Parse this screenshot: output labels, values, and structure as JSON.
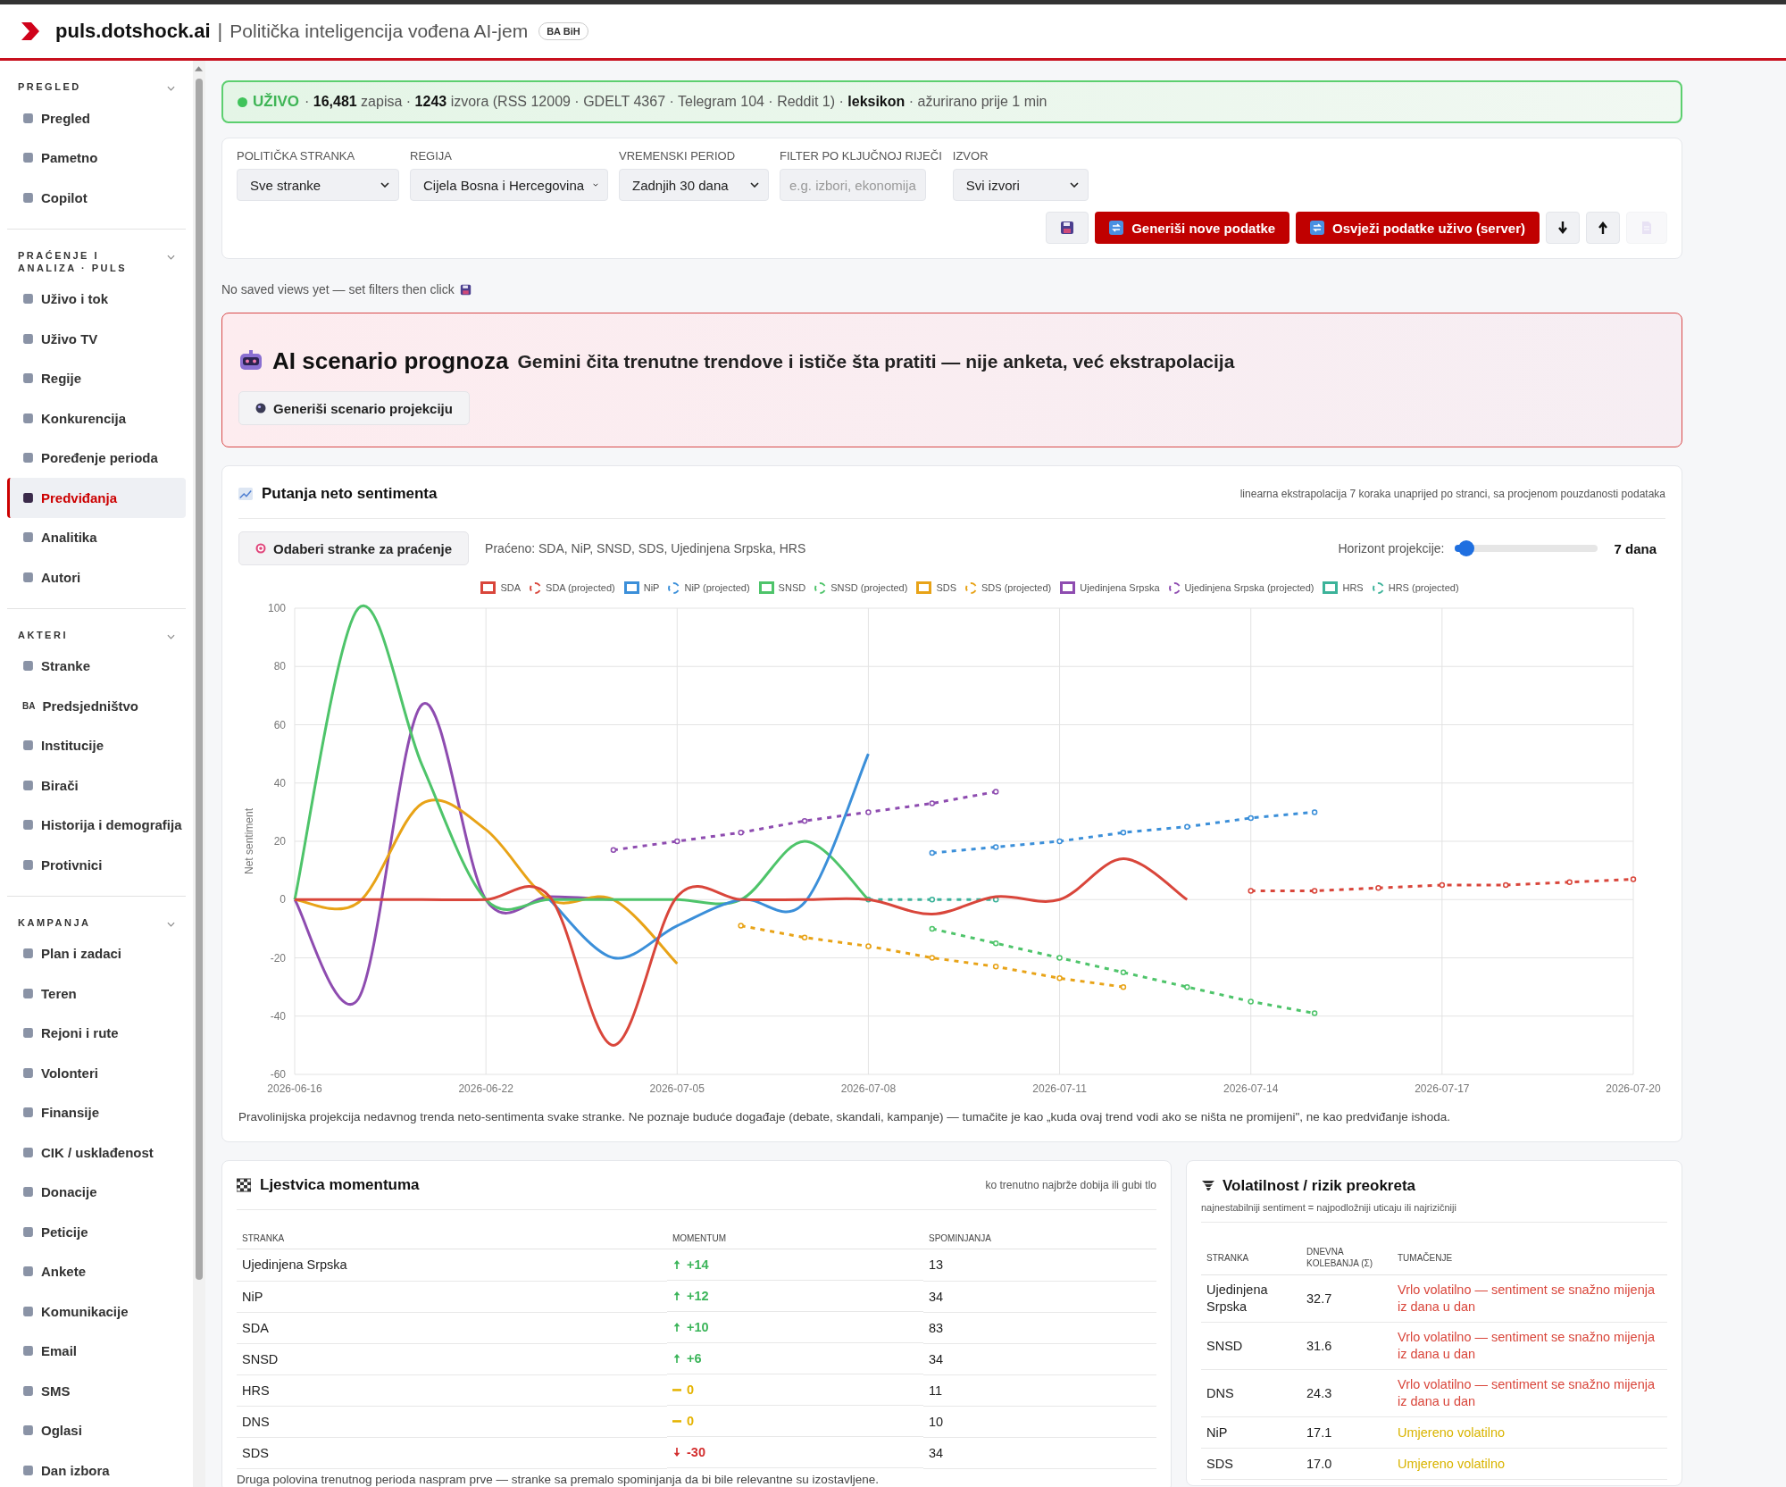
{
  "header": {
    "brand": "puls.dotshock.ai",
    "separator": "|",
    "tagline": "Politička inteligencija vođena AI-jem",
    "badge": "BA BiH"
  },
  "sidebar": {
    "sections": [
      {
        "title": "PREGLED",
        "items": [
          {
            "label": "Pregled",
            "selected": false
          },
          {
            "label": "Pametno",
            "selected": false
          },
          {
            "label": "Copilot",
            "selected": false
          }
        ]
      },
      {
        "title": "PRAĆENJE I ANALIZA · PULS",
        "items": [
          {
            "label": "Uživo i tok",
            "selected": false
          },
          {
            "label": "Uživo TV",
            "selected": false
          },
          {
            "label": "Regije",
            "selected": false
          },
          {
            "label": "Konkurencija",
            "selected": false
          },
          {
            "label": "Poređenje perioda",
            "selected": false
          },
          {
            "label": "Predviđanja",
            "selected": true
          },
          {
            "label": "Analitika",
            "selected": false
          },
          {
            "label": "Autori",
            "selected": false
          }
        ]
      },
      {
        "title": "AKTERI",
        "items": [
          {
            "label": "Stranke",
            "selected": false
          },
          {
            "label": "Predsjedništvo",
            "selected": false,
            "icon_text": "BA"
          },
          {
            "label": "Institucije",
            "selected": false
          },
          {
            "label": "Birači",
            "selected": false
          },
          {
            "label": "Historija i demografija",
            "selected": false
          },
          {
            "label": "Protivnici",
            "selected": false
          }
        ]
      },
      {
        "title": "KAMPANJA",
        "items": [
          {
            "label": "Plan i zadaci",
            "selected": false
          },
          {
            "label": "Teren",
            "selected": false
          },
          {
            "label": "Rejoni i rute",
            "selected": false
          },
          {
            "label": "Volonteri",
            "selected": false
          },
          {
            "label": "Finansije",
            "selected": false
          },
          {
            "label": "CIK / usklađenost",
            "selected": false
          },
          {
            "label": "Donacije",
            "selected": false
          },
          {
            "label": "Peticije",
            "selected": false
          },
          {
            "label": "Ankete",
            "selected": false
          },
          {
            "label": "Komunikacije",
            "selected": false
          },
          {
            "label": "Email",
            "selected": false
          },
          {
            "label": "SMS",
            "selected": false
          },
          {
            "label": "Oglasi",
            "selected": false
          },
          {
            "label": "Dan izbora",
            "selected": false
          }
        ]
      }
    ]
  },
  "live": {
    "status": "UŽIVO",
    "summary": "· **16,481** zapisa · **1243** izvora (RSS 12009 · GDELT 4367 · Telegram 104 · Reddit 1) · **leksikon** · ažurirano prije 1 min"
  },
  "filters": {
    "fields": [
      {
        "label": "POLITIČKA STRANKA",
        "kind": "select",
        "value": "Sve stranke"
      },
      {
        "label": "REGIJA",
        "kind": "select",
        "value": "Cijela Bosna i Hercegovina"
      },
      {
        "label": "VREMENSKI PERIOD",
        "kind": "select",
        "value": "Zadnjih 30 dana"
      },
      {
        "label": "FILTER PO KLJUČNOJ RIJEČI",
        "kind": "input",
        "placeholder": "e.g. izbori, ekonomija"
      },
      {
        "label": "IZVOR",
        "kind": "select",
        "value": "Svi izvori"
      }
    ],
    "buttons": [
      "Generiši nove podatke",
      "Osvježi podatke uživo (server)"
    ],
    "document_button": {
      "disabled": true
    }
  },
  "saved_views": {
    "text": "No saved views yet — set filters then click"
  },
  "ai_scenario": {
    "title": "AI scenario prognoza",
    "subtitle": "Gemini čita trenutne trendove i ističe šta pratiti — nije anketa, već ekstrapolacija",
    "button": "Generiši scenario projekciju"
  },
  "trajectory": {
    "title": "Putanja neto sentimenta",
    "note": "linearna ekstrapolacija 7 koraka unaprijed po stranci, sa procjenom pouzdanosti podataka",
    "pick_button": "Odaberi stranke za praćenje",
    "tracked": "Praćeno: SDA, NiP, SNSD, SDS, Ujedinjena Srpska, HRS",
    "horizon_label": "Horizont projekcije:",
    "horizon": {
      "level": 0.08
    },
    "horizon_value": "7 dana",
    "chart_data": {
      "type": "line",
      "grid": true,
      "legend": "top",
      "ylabel": "Net sentiment",
      "categories": [
        "2026-06-16",
        null,
        null,
        "2026-06-22",
        null,
        null,
        "2026-07-05",
        null,
        null,
        "2026-07-08",
        null,
        null,
        "2026-07-11",
        null,
        null,
        "2026-07-14",
        null,
        null,
        "2026-07-17",
        null,
        null,
        "2026-07-20"
      ],
      "ylim": [
        -60,
        100
      ],
      "yticks": [
        -60,
        -40,
        -20,
        0,
        20,
        40,
        60,
        80,
        100
      ],
      "series": [
        {
          "name": "SDA",
          "color": "#d9463b",
          "values": [
            0,
            0,
            0,
            0,
            1,
            -50,
            1,
            0,
            0,
            0,
            -5,
            1,
            0,
            14,
            0,
            null,
            null,
            null,
            null,
            null,
            null,
            null
          ]
        },
        {
          "name": "SDA (projected)",
          "line_style": "dashed",
          "marker": "circle",
          "color": "#d9463b",
          "values": [
            null,
            null,
            null,
            null,
            null,
            null,
            null,
            null,
            null,
            null,
            null,
            null,
            null,
            null,
            null,
            3,
            3,
            4,
            5,
            5,
            6,
            7
          ]
        },
        {
          "name": "NiP",
          "color": "#3b8fd9",
          "values": [
            null,
            null,
            null,
            null,
            0,
            -20,
            -9,
            0,
            -1,
            50,
            null,
            null,
            null,
            null,
            null,
            null,
            null,
            null,
            null,
            null,
            null,
            null
          ]
        },
        {
          "name": "NiP (projected)",
          "line_style": "dashed",
          "marker": "circle",
          "color": "#3b8fd9",
          "values": [
            null,
            null,
            null,
            null,
            null,
            null,
            null,
            null,
            null,
            null,
            16,
            18,
            20,
            23,
            25,
            28,
            30,
            null,
            null,
            null,
            null,
            null
          ]
        },
        {
          "name": "SNSD",
          "color": "#4ec46a",
          "values": [
            0,
            100,
            46,
            0,
            0,
            0,
            0,
            0,
            20,
            0,
            null,
            null,
            null,
            null,
            null,
            null,
            null,
            null,
            null,
            null,
            null,
            null
          ]
        },
        {
          "name": "SNSD (projected)",
          "line_style": "dashed",
          "marker": "circle",
          "color": "#4ec46a",
          "values": [
            null,
            null,
            null,
            null,
            null,
            null,
            null,
            null,
            null,
            null,
            -10,
            -15,
            -20,
            -25,
            -30,
            -35,
            -39,
            null,
            null,
            null,
            null,
            null
          ]
        },
        {
          "name": "SDS",
          "color": "#e8a317",
          "values": [
            0,
            -1,
            33,
            24,
            0,
            0,
            -22,
            null,
            null,
            null,
            null,
            null,
            null,
            null,
            null,
            null,
            null,
            null,
            null,
            null,
            null,
            null
          ]
        },
        {
          "name": "SDS (projected)",
          "line_style": "dashed",
          "marker": "circle",
          "color": "#e8a317",
          "values": [
            null,
            null,
            null,
            null,
            null,
            null,
            null,
            -9,
            -13,
            -16,
            -20,
            -23,
            -27,
            -30,
            null,
            null,
            null,
            null,
            null,
            null,
            null,
            null
          ]
        },
        {
          "name": "Ujedinjena Srpska",
          "color": "#8e4cb0",
          "values": [
            0,
            -34,
            67,
            0,
            1,
            0,
            null,
            null,
            null,
            null,
            null,
            null,
            null,
            null,
            null,
            null,
            null,
            null,
            null,
            null,
            null,
            null
          ]
        },
        {
          "name": "Ujedinjena Srpska (projected)",
          "line_style": "dashed",
          "marker": "circle",
          "color": "#8e4cb0",
          "values": [
            null,
            null,
            null,
            null,
            null,
            17,
            20,
            23,
            27,
            30,
            33,
            37,
            null,
            null,
            null,
            null,
            null,
            null,
            null,
            null,
            null,
            null
          ]
        },
        {
          "name": "HRS",
          "color": "#3cb39a",
          "values": [
            null,
            null,
            null,
            null,
            null,
            null,
            null,
            null,
            null,
            null,
            null,
            null,
            null,
            null,
            null,
            null,
            null,
            null,
            null,
            null,
            null,
            null
          ]
        },
        {
          "name": "HRS (projected)",
          "line_style": "dashed",
          "marker": "circle",
          "color": "#3cb39a",
          "values": [
            null,
            null,
            null,
            null,
            null,
            null,
            null,
            null,
            null,
            0,
            0,
            0,
            null,
            null,
            null,
            null,
            null,
            null,
            null,
            null,
            null,
            null
          ]
        }
      ]
    },
    "footnote": "Pravolinijska projekcija nedavnog trenda neto-sentimenta svake stranke. Ne poznaje buduće događaje (debate, skandali, kampanje) — tumačite je kao „kuda ovaj trend vodi ako se ništa ne promijeni\", ne kao predviđanje ishoda."
  },
  "momentum": {
    "title": "Ljestvica momentuma",
    "note": "ko trenutno najbrže dobija ili gubi tlo",
    "columns": [
      "STRANKA",
      "MOMENTUM",
      "SPOMINJANJA"
    ],
    "rows": [
      {
        "party": "Ujedinjena Srpska",
        "kind": "up",
        "momentum": "+14",
        "mentions": "13"
      },
      {
        "party": "NiP",
        "kind": "up",
        "momentum": "+12",
        "mentions": "34"
      },
      {
        "party": "SDA",
        "kind": "up",
        "momentum": "+10",
        "mentions": "83"
      },
      {
        "party": "SNSD",
        "kind": "up",
        "momentum": "+6",
        "mentions": "34"
      },
      {
        "party": "HRS",
        "kind": "flat",
        "momentum": "0",
        "mentions": "11"
      },
      {
        "party": "DNS",
        "kind": "flat",
        "momentum": "0",
        "mentions": "10"
      },
      {
        "party": "SDS",
        "kind": "down",
        "momentum": "-30",
        "mentions": "34"
      }
    ],
    "footnote": "Druga polovina trenutnog perioda naspram prve — stranke sa premalo spominjanja da bi bile relevantne su izostavljene."
  },
  "volatility": {
    "title": "Volatilnost / rizik preokreta",
    "subtitle": "najnestabilniji sentiment = najpodložniji uticaju ili najrizičniji",
    "columns": [
      "STRANKA",
      "DNEVNA KOLEBANJA (Σ)",
      "TUMAČENJE"
    ],
    "rows": [
      {
        "party": "Ujedinjena Srpska",
        "sigma": "32.7",
        "kind": "high",
        "reading": "Vrlo volatilno — sentiment se snažno mijenja iz dana u dan"
      },
      {
        "party": "SNSD",
        "sigma": "31.6",
        "kind": "high",
        "reading": "Vrlo volatilno — sentiment se snažno mijenja iz dana u dan"
      },
      {
        "party": "DNS",
        "sigma": "24.3",
        "kind": "high",
        "reading": "Vrlo volatilno — sentiment se snažno mijenja iz dana u dan"
      },
      {
        "party": "NiP",
        "sigma": "17.1",
        "kind": "medium",
        "reading": "Umjereno volatilno"
      },
      {
        "party": "SDS",
        "sigma": "17.0",
        "kind": "medium",
        "reading": "Umjereno volatilno"
      }
    ]
  }
}
